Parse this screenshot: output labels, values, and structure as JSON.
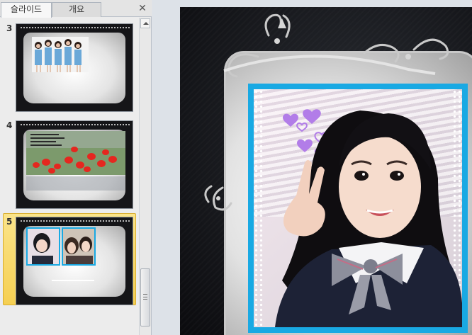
{
  "panel": {
    "tabs": [
      {
        "label": "슬라이드",
        "active": true
      },
      {
        "label": "개요",
        "active": false
      }
    ],
    "close_icon": "close-icon"
  },
  "thumbnails": [
    {
      "number": "3",
      "selected": false
    },
    {
      "number": "4",
      "selected": false
    },
    {
      "number": "5",
      "selected": true
    }
  ],
  "colors": {
    "selection": "#f5cf52",
    "photo_frame": "#19a9e3",
    "slide_background": "#141519"
  }
}
